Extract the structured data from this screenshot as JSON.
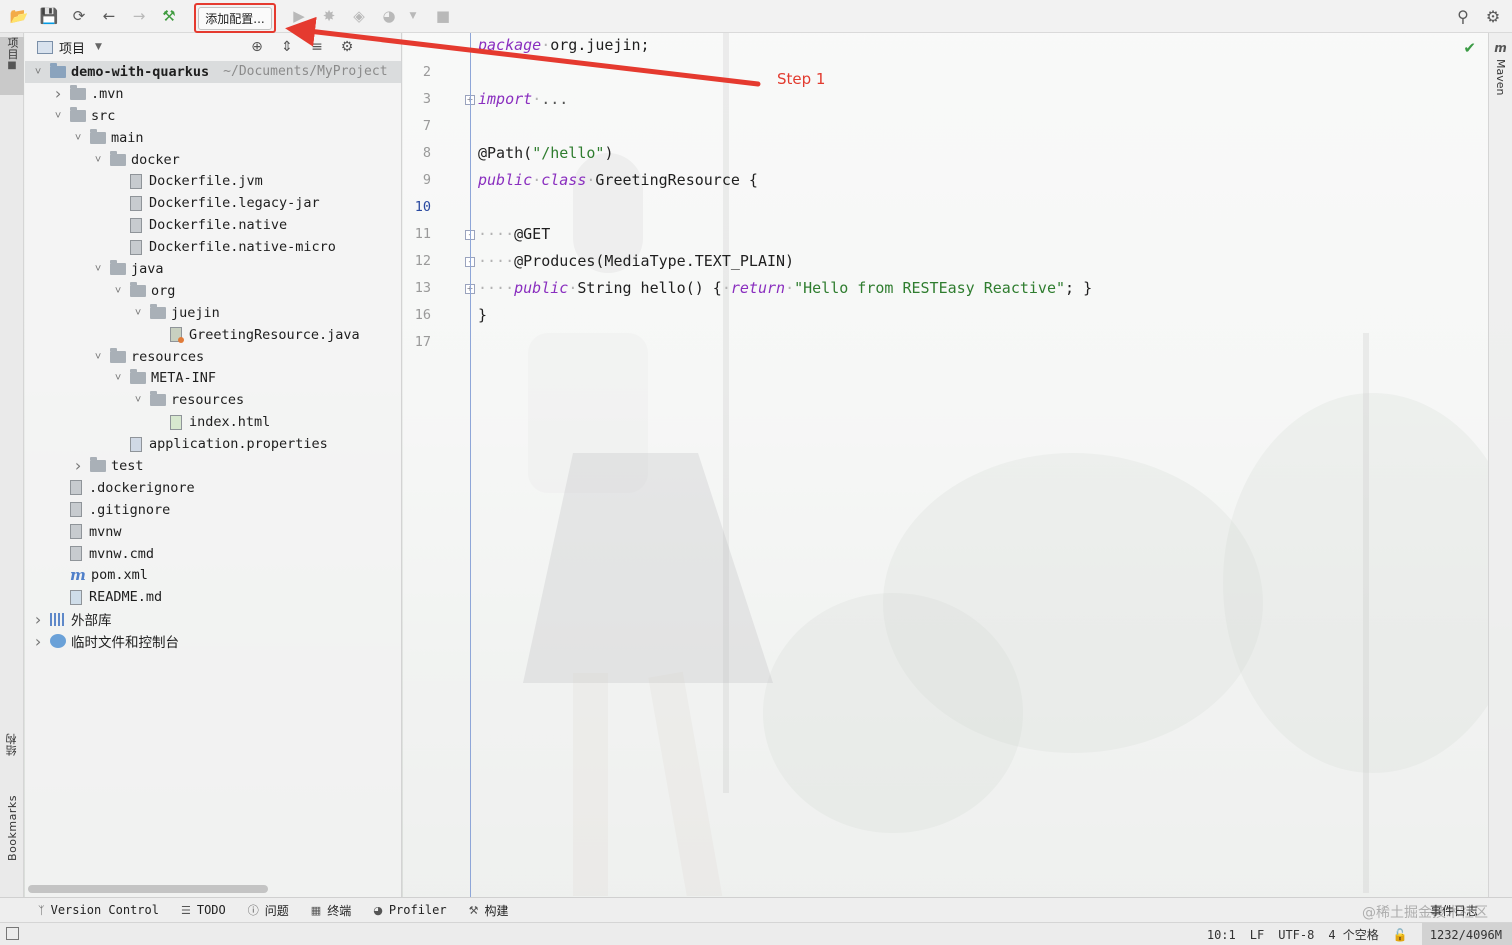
{
  "toolbar": {
    "run_config_label": "添加配置..."
  },
  "annotation": {
    "step_label": "Step 1",
    "color": "#e53a2f"
  },
  "left_strip": {
    "project_tab": "项目",
    "structure_tab": "结构",
    "bookmarks_tab": "Bookmarks"
  },
  "right_strip": {
    "maven_tab": "Maven"
  },
  "project_panel": {
    "title": "项目",
    "tree": [
      {
        "label": "demo-with-quarkus",
        "hint": "~/Documents/MyProject",
        "level": 0,
        "type": "module",
        "expanded": true
      },
      {
        "label": ".mvn",
        "level": 1,
        "type": "folder",
        "expanded": false
      },
      {
        "label": "src",
        "level": 1,
        "type": "folder",
        "expanded": true
      },
      {
        "label": "main",
        "level": 2,
        "type": "folder",
        "expanded": true
      },
      {
        "label": "docker",
        "level": 3,
        "type": "folder",
        "expanded": true
      },
      {
        "label": "Dockerfile.jvm",
        "level": 4,
        "type": "file"
      },
      {
        "label": "Dockerfile.legacy-jar",
        "level": 4,
        "type": "file"
      },
      {
        "label": "Dockerfile.native",
        "level": 4,
        "type": "file"
      },
      {
        "label": "Dockerfile.native-micro",
        "level": 4,
        "type": "file"
      },
      {
        "label": "java",
        "level": 3,
        "type": "folder",
        "expanded": true
      },
      {
        "label": "org",
        "level": 4,
        "type": "folder",
        "expanded": true
      },
      {
        "label": "juejin",
        "level": 5,
        "type": "folder",
        "expanded": true
      },
      {
        "label": "GreetingResource.java",
        "level": 6,
        "type": "java"
      },
      {
        "label": "resources",
        "level": 3,
        "type": "folder",
        "expanded": true
      },
      {
        "label": "META-INF",
        "level": 4,
        "type": "folder",
        "expanded": true
      },
      {
        "label": "resources",
        "level": 5,
        "type": "folder",
        "expanded": true
      },
      {
        "label": "index.html",
        "level": 6,
        "type": "html"
      },
      {
        "label": "application.properties",
        "level": 4,
        "type": "props"
      },
      {
        "label": "test",
        "level": 2,
        "type": "folder",
        "expanded": false
      },
      {
        "label": ".dockerignore",
        "level": 1,
        "type": "file"
      },
      {
        "label": ".gitignore",
        "level": 1,
        "type": "file"
      },
      {
        "label": "mvnw",
        "level": 1,
        "type": "file"
      },
      {
        "label": "mvnw.cmd",
        "level": 1,
        "type": "file"
      },
      {
        "label": "pom.xml",
        "level": 1,
        "type": "maven"
      },
      {
        "label": "README.md",
        "level": 1,
        "type": "md"
      },
      {
        "label": "外部库",
        "level": 0,
        "type": "libs",
        "expanded": false
      },
      {
        "label": "临时文件和控制台",
        "level": 0,
        "type": "scratch",
        "expanded": false
      }
    ]
  },
  "editor": {
    "line_numbers": [
      "",
      "2",
      "3",
      "7",
      "8",
      "9",
      "10",
      "11",
      "12",
      "13",
      "16",
      "17"
    ],
    "current_line": "10",
    "code": {
      "l1_kw": "package",
      "l1_rest": "org.juejin;",
      "l3_kw": "import",
      "l3_rest": "...",
      "l8_ann": "@Path(",
      "l8_str": "\"/hello\"",
      "l8_end": ")",
      "l9_kw1": "public",
      "l9_kw2": "class",
      "l9_rest": "GreetingResource {",
      "l11": "@GET",
      "l12": "@Produces(MediaType.TEXT_PLAIN)",
      "l13_kw1": "public",
      "l13_mid": "String hello() {",
      "l13_kw2": "return",
      "l13_str": "\"Hello from RESTEasy Reactive\"",
      "l13_end": "; }",
      "l16": "}"
    }
  },
  "bottom_bar": {
    "items": [
      {
        "icon": "branch-icon",
        "label": "Version Control"
      },
      {
        "icon": "todo-icon",
        "label": "TODO"
      },
      {
        "icon": "problems-icon",
        "label": "问题"
      },
      {
        "icon": "terminal-icon",
        "label": "终端"
      },
      {
        "icon": "profiler-icon",
        "label": "Profiler"
      },
      {
        "icon": "build-icon",
        "label": "构建"
      }
    ],
    "event_log": "事件日志",
    "watermark": "@稀土掘金技术社区"
  },
  "status_bar": {
    "position": "10:1",
    "line_sep": "LF",
    "encoding": "UTF-8",
    "indent": "4 个空格",
    "memory": "1232/4096M"
  }
}
